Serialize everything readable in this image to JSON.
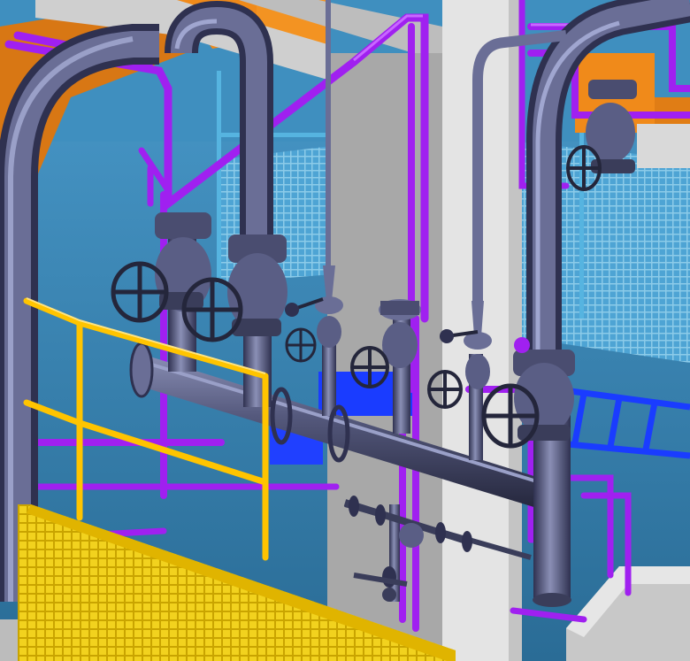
{
  "scene": {
    "kind": "3D piping plant model render",
    "colors": {
      "sky": "#2d6f94",
      "wall_blue": "#3f8fbf",
      "concrete": "#d9d9d9",
      "concrete_shade": "#a9a9a9",
      "orange": "#f08a1a",
      "pipe_dark": "#474a68",
      "pipe_light": "#8a8fb5",
      "magenta": "#a020f0",
      "magenta_light": "#c060ff",
      "cyan": "#56b4e0",
      "yellow": "#ffc400",
      "yellow_grate": "#f2d21e",
      "blue_tray": "#1a3cff"
    }
  }
}
